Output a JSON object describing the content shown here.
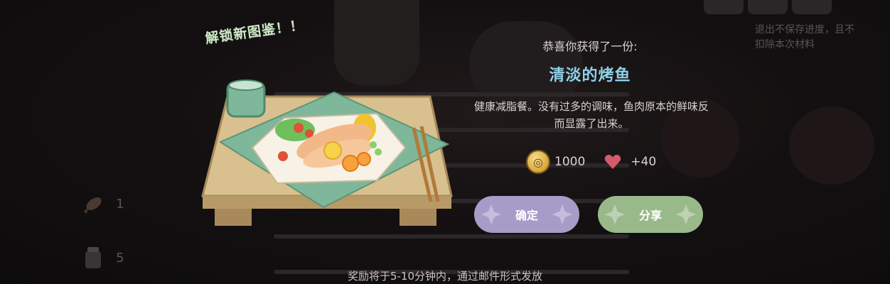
{
  "unlock_banner": "解锁新图鉴！！",
  "exit_note": "退出不保存进度，且不扣除本次材料",
  "left_resources": [
    {
      "icon": "fish-icon",
      "count": "1"
    },
    {
      "icon": "jar-icon",
      "count": "5"
    }
  ],
  "result": {
    "congrats": "恭喜你获得了一份:",
    "dish_name": "清淡的烤鱼",
    "description": "健康减脂餐。没有过多的调味，鱼肉原本的鲜味反而显露了出来。"
  },
  "rewards": {
    "coin_icon": "coin-icon",
    "coin_value": "1000",
    "affinity_icon": "heart-icon",
    "affinity_value": "+40"
  },
  "buttons": {
    "confirm_label": "确定",
    "share_label": "分享"
  },
  "footer_note": "奖励将于5-10分钟内，通过邮件形式发放",
  "colors": {
    "dish_name": "#8fd0ea",
    "confirm_button": "#a79bc8",
    "share_button": "#9ab98b",
    "unlock_banner": "#cfe8c8"
  }
}
